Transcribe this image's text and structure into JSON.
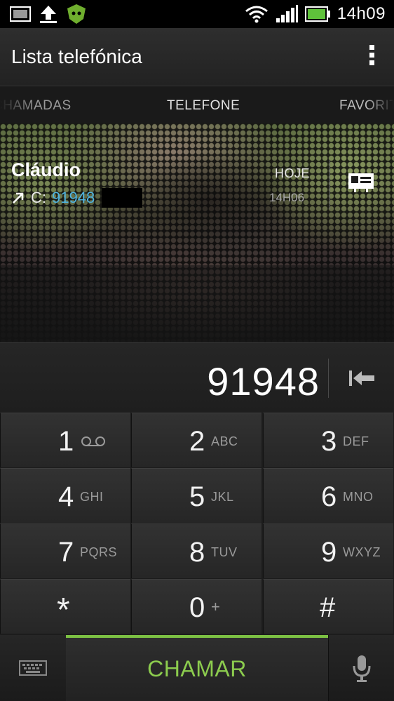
{
  "status_bar": {
    "time": "14h09",
    "icons": [
      "gallery-notification-icon",
      "upload-icon",
      "antivirus-icon",
      "wifi-icon",
      "signal-icon",
      "battery-icon"
    ]
  },
  "app_bar": {
    "title": "Lista telefónica",
    "menu_icon": "overflow-menu-icon"
  },
  "tabs": [
    {
      "label": "CHAMADAS"
    },
    {
      "label": "TELEFONE"
    },
    {
      "label": "FAVORITOS"
    }
  ],
  "recent_call": {
    "name": "Cláudio",
    "number_prefix": "C:",
    "number": "91948",
    "day": "HOJE",
    "time": "14H06"
  },
  "dialer": {
    "number": "91948"
  },
  "keypad": [
    {
      "digit": "1",
      "letters": ""
    },
    {
      "digit": "2",
      "letters": "ABC"
    },
    {
      "digit": "3",
      "letters": "DEF"
    },
    {
      "digit": "4",
      "letters": "GHI"
    },
    {
      "digit": "5",
      "letters": "JKL"
    },
    {
      "digit": "6",
      "letters": "MNO"
    },
    {
      "digit": "7",
      "letters": "PQRS"
    },
    {
      "digit": "8",
      "letters": "TUV"
    },
    {
      "digit": "9",
      "letters": "WXYZ"
    },
    {
      "digit": "*",
      "letters": ""
    },
    {
      "digit": "0",
      "letters": "+"
    },
    {
      "digit": "#",
      "letters": ""
    }
  ],
  "bottom_bar": {
    "call_label": "CHAMAR"
  },
  "colors": {
    "accent_green": "#7cc043",
    "link_blue": "#4fb4e0"
  }
}
